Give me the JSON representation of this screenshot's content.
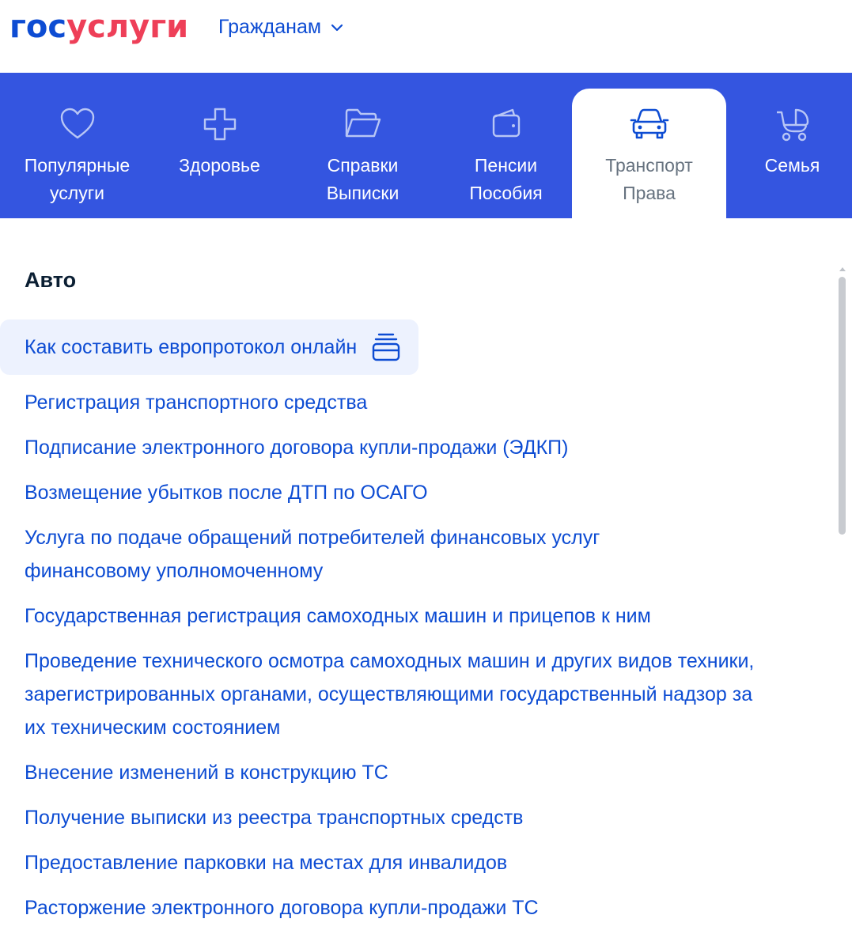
{
  "header": {
    "logo_part1": "гос",
    "logo_part2": "услуги",
    "audience_label": "Гражданам"
  },
  "categories": [
    {
      "line1": "Популярные",
      "line2": "услуги",
      "icon": "heart-icon",
      "active": false
    },
    {
      "line1": "Здоровье",
      "line2": "",
      "icon": "medical-cross-icon",
      "active": false
    },
    {
      "line1": "Справки",
      "line2": "Выписки",
      "icon": "folder-icon",
      "active": false
    },
    {
      "line1": "Пенсии",
      "line2": "Пособия",
      "icon": "wallet-icon",
      "active": false
    },
    {
      "line1": "Транспорт",
      "line2": "Права",
      "icon": "car-icon",
      "active": true
    },
    {
      "line1": "Семья",
      "line2": "",
      "icon": "stroller-icon",
      "active": false
    }
  ],
  "section": {
    "title": "Авто",
    "items": [
      "Как составить европротокол онлайн",
      "Регистрация транспортного средства",
      "Подписание электронного договора купли-продажи (ЭДКП)",
      "Возмещение убытков после ДТП по ОСАГО",
      "Услуга по подаче обращений потребителей финансовых услуг финансовому уполномоченному",
      "Государственная регистрация самоходных машин и прицепов к ним",
      "Проведение технического осмотра самоходных машин и других видов техники, зарегистрированных органами, осуществляющими государственный надзор за их техническим состоянием",
      "Внесение изменений в конструкцию ТС",
      "Получение выписки из реестра транспортных средств",
      "Предоставление парковки на местах для инвалидов",
      "Расторжение электронного договора купли-продажи ТС"
    ]
  },
  "colors": {
    "brand_blue": "#0d4cd3",
    "brand_red": "#ee3f58",
    "category_bar": "#3455e0",
    "featured_bg": "#edf2fe"
  }
}
